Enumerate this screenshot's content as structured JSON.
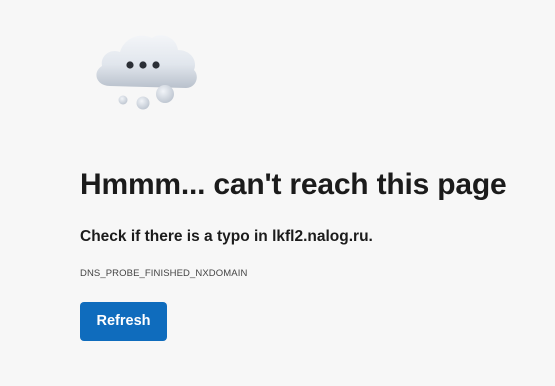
{
  "illustration": {
    "icon": "cloud-thinking-icon",
    "colors": {
      "cloud_light": "#eef1f5",
      "cloud_shade": "#c8ced8",
      "dots": "#2b2f36"
    }
  },
  "error": {
    "headline": "Hmmm... can't reach this page",
    "message": "Check if there is a typo in lkfl2.nalog.ru.",
    "code": "DNS_PROBE_FINISHED_NXDOMAIN"
  },
  "actions": {
    "refresh_label": "Refresh"
  },
  "colors": {
    "background": "#f7f7f7",
    "accent": "#0f6cbd",
    "text": "#1b1b1b"
  }
}
